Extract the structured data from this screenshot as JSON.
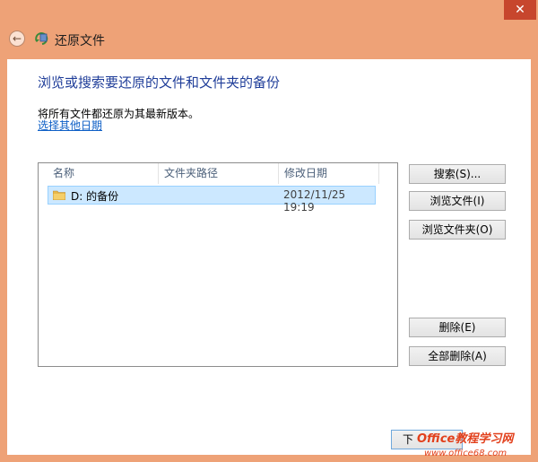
{
  "window": {
    "title": "还原文件",
    "close_glyph": "✕",
    "back_glyph": "←"
  },
  "main": {
    "heading": "浏览或搜索要还原的文件和文件夹的备份",
    "description": "将所有文件都还原为其最新版本。",
    "choose_date_link": "选择其他日期"
  },
  "list": {
    "columns": [
      "名称",
      "文件夹路径",
      "修改日期"
    ],
    "rows": [
      {
        "name": "D: 的备份",
        "path": "",
        "date": "2012/11/25 19:19",
        "icon": "folder-icon"
      }
    ]
  },
  "buttons": {
    "search": "搜索(S)...",
    "browse_files": "浏览文件(I)",
    "browse_folders": "浏览文件夹(O)",
    "remove": "删除(E)",
    "remove_all": "全部删除(A)",
    "next": "下"
  },
  "watermark": {
    "line1": "Office教程学习网",
    "line2": "www.office68.com"
  },
  "colors": {
    "titlebar": "#eea277",
    "heading": "#1f3d99",
    "link": "#0e5fc6",
    "selection": "#cce8ff",
    "close": "#c7462d"
  }
}
